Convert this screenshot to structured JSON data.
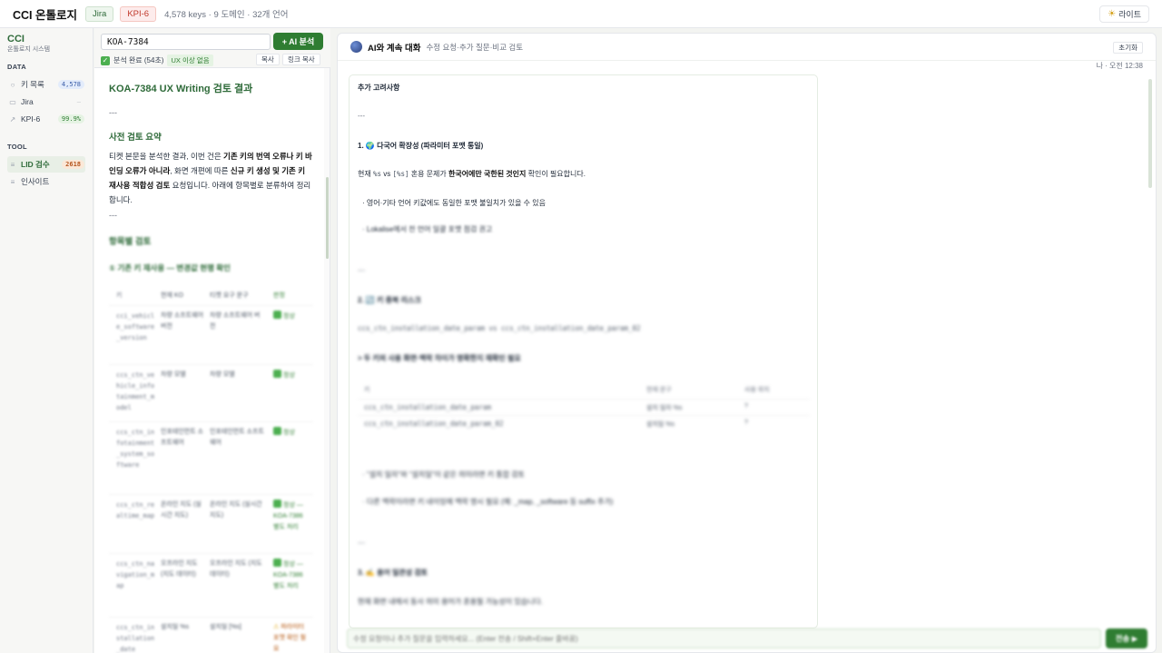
{
  "topbar": {
    "title": "CCI 온톨로지",
    "badge_jira": "Jira",
    "badge_kpi": "KPI-6",
    "stats": "4,578 keys · 9 도메인 · 32개 언어",
    "theme_label": "라이트"
  },
  "sidebar": {
    "brand": "CCI",
    "brand_sub": "온톨로지 시스템",
    "data_title": "DATA",
    "data_items": [
      {
        "label": "키 목록",
        "count": "4,578",
        "icon": "search-icon"
      },
      {
        "label": "Jira",
        "count": "—",
        "icon": "square-icon"
      },
      {
        "label": "KPI-6",
        "count": "99.9%",
        "icon": "chart-icon"
      }
    ],
    "tool_title": "TOOL",
    "tool_items": [
      {
        "label": "LID 검수",
        "count": "2618",
        "icon": "filter-icon",
        "active": true
      },
      {
        "label": "인사이트",
        "icon": "filter-icon"
      }
    ]
  },
  "middle": {
    "key_value": "KOA-7384",
    "ai_button": "+ AI 분석",
    "status": "분석 완료 (54초)",
    "ux_badge": "UX 이상 없음",
    "copy_btn": "복사",
    "link_copy_btn": "링크 복사",
    "doc_title": "KOA-7384 UX Writing 검토 결과",
    "sep": "---",
    "summary_h": "사전 검토 요약",
    "summary_parts": [
      "티켓 본문을 분석한 결과, 이번 건은 ",
      "기존 키의 번역 오류나 키 바인딩 오류가 아니라",
      ", 화면 개편에 따른 ",
      "신규 키 생성 및 기존 키 재사용 적합성 검토",
      " 요청입니다. 아래에 항목별로 분류하여 정리합니다."
    ],
    "sep2": "---",
    "items_h": "항목별 검토",
    "items_sub": "① 기존 키 재사용 — 변경값 현행 확인",
    "table_head": [
      "키",
      "현재 KO",
      "티켓 요구 문구",
      "판정"
    ],
    "table_rows": [
      {
        "key": "cci_vehicle_software_version",
        "cur": "차량 소프트웨어 버전",
        "req": "차량 소프트웨어 버전",
        "res": "정상"
      },
      {
        "key": "ccs_ctn_vehicle_infotainment_model",
        "cur": "차량 모델",
        "req": "차량 모델",
        "res": "정상"
      },
      {
        "key": "ccs_ctn_infotainment_system_software",
        "cur": "인포테인먼트 소프트웨어",
        "req": "인포테인먼트 소프트웨어",
        "res": "정상"
      },
      {
        "key": "ccs_ctn_realtime_map",
        "cur": "온라인 지도 (실시간 지도)",
        "req": "온라인 지도 (실시간 지도)",
        "res": "정상 — KOA-7386 별도 처리"
      },
      {
        "key": "ccs_ctn_navigation_map",
        "cur": "오프라인 지도 (지도 데이터)",
        "req": "오프라인 지도 (지도 데이터)",
        "res": "정상 — KOA-7386 별도 처리"
      },
      {
        "key": "ccs_ctn_installation_date",
        "cur": "설치일 %s",
        "req": "설치일 [%s]",
        "res": "파라미터 포맷 확인 필요"
      }
    ]
  },
  "chat": {
    "title": "AI와 계속 대화",
    "subtitle": "수정 요청·추가 질문·비교 검토",
    "reset": "초기화",
    "meta": "나 · 오전 12:38",
    "h_extra": "추가 고려사항",
    "sep": "---",
    "p1_title": "1. 🌍 다국어 확장성 (파라미터 포맷 통일)",
    "p1_text_parts": [
      "현재 ",
      "%s",
      " vs ",
      "[%s]",
      " 혼용 문제가 ",
      "한국어에만 국한된 것인지",
      " 확인이 필요합니다."
    ],
    "p1_bullet1": "· 영어·기타 언어 키값에도 동일한 포맷 불일치가 있을 수 있음",
    "p1_bullet2": "· Lokalise에서 전 언어 일괄 포맷 점검 권고",
    "p2_title": "2. 🔄 키 중복 리스크",
    "p2_code": "ccs_ctn_installation_date_param vs ccs_ctn_installation_date_param_02",
    "p2_quote": "> 두 키의 사용 화면·맥락 차이가 명확한지 재확인 필요",
    "p2_tbl_head": [
      "키",
      "현재 문구",
      "사용 위치"
    ],
    "p2_tbl_rows": [
      {
        "key": "ccs_ctn_installation_date_param",
        "text": "설치 일자 %s",
        "loc": "?"
      },
      {
        "key": "ccs_ctn_installation_date_param_02",
        "text": "설치일 %s",
        "loc": "?"
      }
    ],
    "p2_bullet1": "· \"설치 일자\"와 \"설치일\"이 같은 의미라면 키 통합 검토",
    "p2_bullet2": "· 다른 맥락이라면 키 네이밍에 맥락 명시 필요 (예: _map, _software 등 suffix 추가)",
    "p3_title": "3. ✍️ 용어 일관성 검토",
    "p3_text": "현재 화면 내에서 동사 의미 용어가 혼용될 가능성이 있습니다.",
    "input_placeholder": "수정 요청이나 추가 질문을 입력하세요... (Enter 전송 / Shift+Enter 줄바꿈)",
    "send": "전송 ▶"
  },
  "colors": {
    "accent": "#2f7d32",
    "brand": "#2f6b3a",
    "kpi": "#c0392b"
  }
}
